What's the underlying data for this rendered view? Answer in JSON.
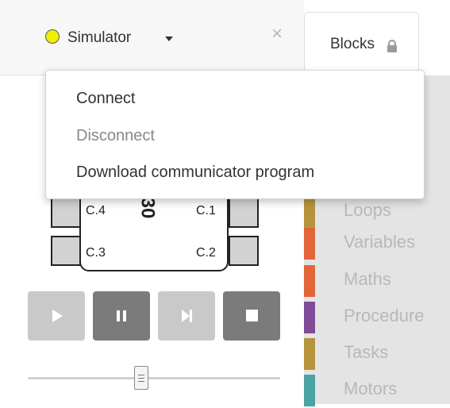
{
  "header": {
    "simulator_label": "Simulator",
    "close_glyph": "×",
    "blocks_tab_label": "Blocks"
  },
  "status_dot_color": "#eeee00",
  "dropdown": {
    "items": [
      {
        "label": "Connect",
        "enabled": true
      },
      {
        "label": "Disconnect",
        "enabled": false
      },
      {
        "label": "Download communicator program",
        "enabled": true
      }
    ]
  },
  "robot": {
    "ports": [
      "C.4",
      "C.1",
      "C.3",
      "C.2"
    ],
    "mark": "30"
  },
  "controls": [
    "play-icon",
    "pause-icon",
    "step-icon",
    "stop-icon"
  ],
  "slider": {
    "value_fraction": 0.45
  },
  "categories": [
    {
      "label": "Loops",
      "color": "#b7943c"
    },
    {
      "label": "Variables",
      "color": "#e3663a"
    },
    {
      "label": "Maths",
      "color": "#e3663a"
    },
    {
      "label": "Procedure",
      "color": "#7e4c98"
    },
    {
      "label": "Tasks",
      "color": "#b7943c"
    },
    {
      "label": "Motors",
      "color": "#4aa3a3"
    }
  ]
}
